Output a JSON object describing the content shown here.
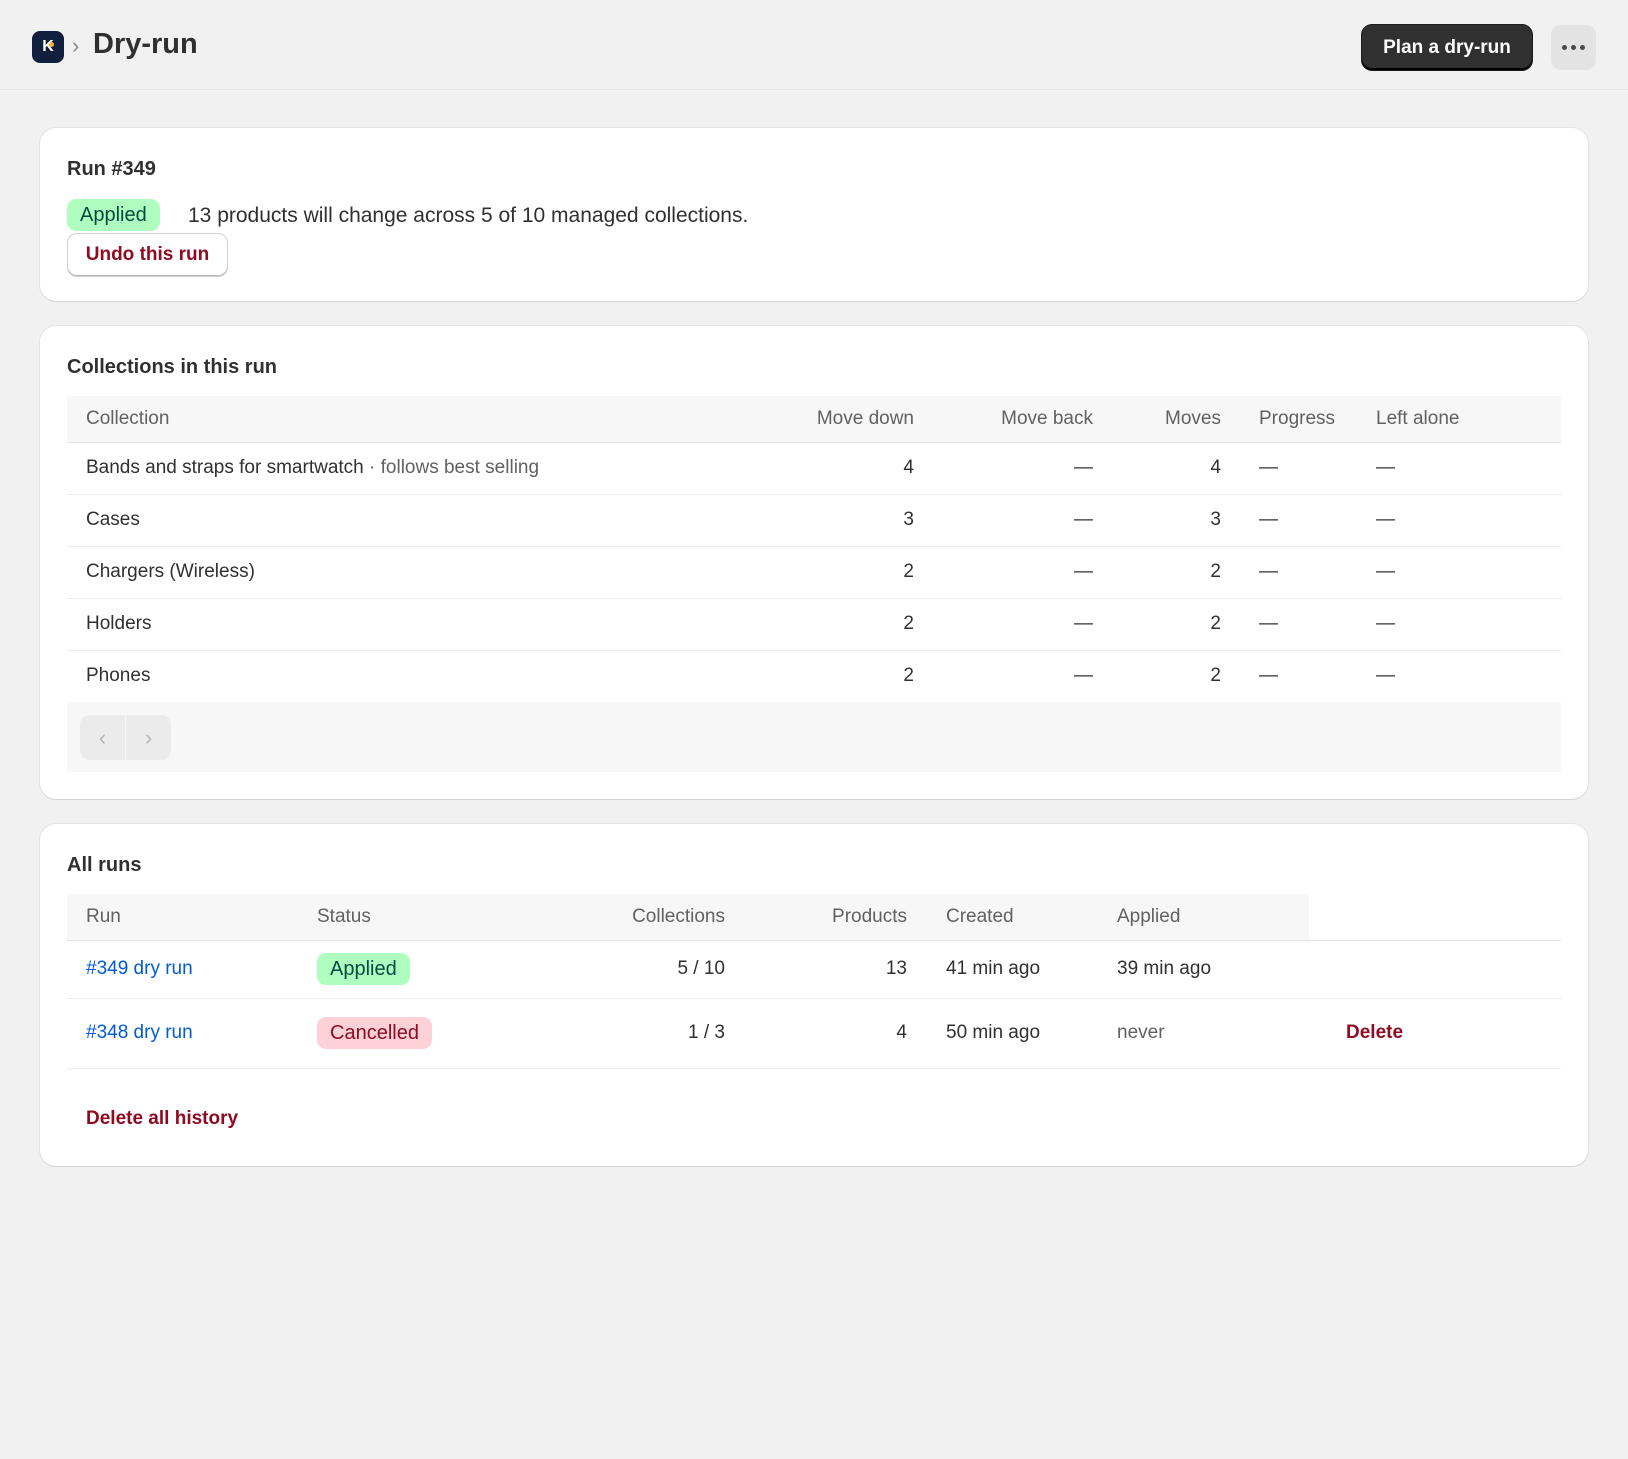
{
  "header": {
    "app_logo_letter": "K",
    "breadcrumb_separator": "›",
    "title": "Dry-run",
    "primary_action": "Plan a dry-run"
  },
  "run_summary": {
    "title": "Run #349",
    "status": "Applied",
    "summary": "13 products will change across 5 of 10 managed collections.",
    "undo_label": "Undo this run"
  },
  "collections": {
    "title": "Collections in this run",
    "columns": [
      "Collection",
      "Move down",
      "Move back",
      "Moves",
      "Progress",
      "Left alone"
    ],
    "rows": [
      {
        "name": "Bands and straps for smartwatch",
        "note": " · follows best selling",
        "move_down": "4",
        "move_back": "—",
        "moves": "4",
        "progress": "—",
        "left_alone": "—"
      },
      {
        "name": "Cases",
        "note": "",
        "move_down": "3",
        "move_back": "—",
        "moves": "3",
        "progress": "—",
        "left_alone": "—"
      },
      {
        "name": "Chargers (Wireless)",
        "note": "",
        "move_down": "2",
        "move_back": "—",
        "moves": "2",
        "progress": "—",
        "left_alone": "—"
      },
      {
        "name": "Holders",
        "note": "",
        "move_down": "2",
        "move_back": "—",
        "moves": "2",
        "progress": "—",
        "left_alone": "—"
      },
      {
        "name": "Phones",
        "note": "",
        "move_down": "2",
        "move_back": "—",
        "moves": "2",
        "progress": "—",
        "left_alone": "—"
      }
    ],
    "pager_prev": "‹",
    "pager_next": "›"
  },
  "all_runs": {
    "title": "All runs",
    "columns": [
      "Run",
      "Status",
      "Collections",
      "Products",
      "Created",
      "Applied"
    ],
    "rows": [
      {
        "run": "#349 dry run",
        "status": "Applied",
        "collections": "5 / 10",
        "products": "13",
        "created": "41 min ago",
        "applied": "39 min ago",
        "action": ""
      },
      {
        "run": "#348 dry run",
        "status": "Cancelled",
        "collections": "1 / 3",
        "products": "4",
        "created": "50 min ago",
        "applied": "never",
        "action": "Delete"
      }
    ],
    "delete_all_label": "Delete all history"
  },
  "colors": {
    "primary": "#303030",
    "success_bg": "#affebf",
    "critical_bg": "#fed1d7",
    "critical_text": "#8e0b21",
    "link": "#005bd3"
  }
}
